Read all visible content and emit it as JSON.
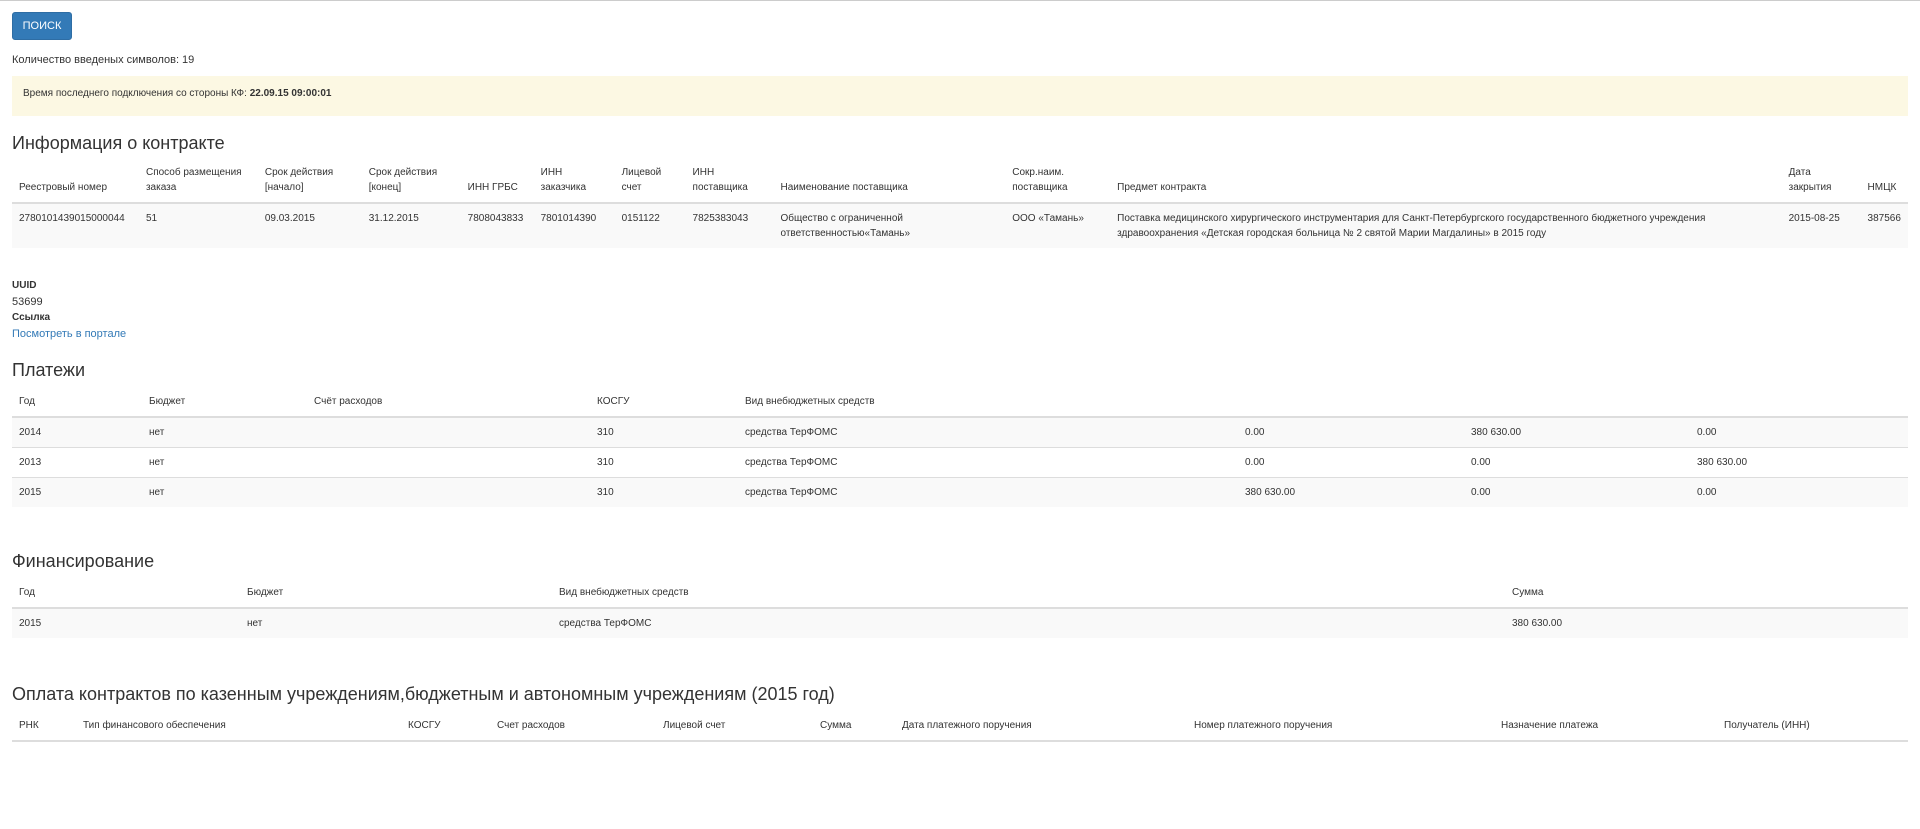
{
  "search_button": "ПОИСК",
  "symbol_count": "Количество введеных символов: 19",
  "alert": {
    "prefix": "Время последнего подключения со стороны КФ: ",
    "value": "22.09.15 09:00:01"
  },
  "contract": {
    "title": "Информация о контракте",
    "headers": [
      "Реестровый номер",
      "Способ размещения заказа",
      "Срок действия [начало]",
      "Срок действия [конец]",
      "ИНН ГРБС",
      "ИНН заказчика",
      "Лицевой счет",
      "ИНН поставщика",
      "Наименование поставщика",
      "Сокр.наим. поставщика",
      "Предмет контракта",
      "Дата закрытия",
      "НМЦК"
    ],
    "row": [
      "2780101439015000044",
      "51",
      "09.03.2015",
      "31.12.2015",
      "7808043833",
      "7801014390",
      "0151122",
      "7825383043",
      "Общество с ограниченной ответственностью«Тамань»",
      "ООО «Тамань»",
      "Поставка медицинского хирургического инструментария для Санкт-Петербургского государственного бюджетного учреждения здравоохранения «Детская городская больница № 2 святой Марии Магдалины» в 2015 году",
      "2015-08-25",
      "387566"
    ]
  },
  "uuid_label": "UUID",
  "uuid_value": "53699",
  "link_label": "Ссылка",
  "link_text": "Посмотреть в портале",
  "payments": {
    "title": "Платежи",
    "headers": [
      "Год",
      "Бюджет",
      "Счёт расходов",
      "КОСГУ",
      "Вид внебюджетных средств",
      "",
      "",
      ""
    ],
    "rows": [
      [
        "2014",
        "нет",
        "",
        "310",
        "средства ТерФОМС",
        "0.00",
        "380 630.00",
        "0.00"
      ],
      [
        "2013",
        "нет",
        "",
        "310",
        "средства ТерФОМС",
        "0.00",
        "0.00",
        "380 630.00"
      ],
      [
        "2015",
        "нет",
        "",
        "310",
        "средства ТерФОМС",
        "380 630.00",
        "0.00",
        "0.00"
      ]
    ]
  },
  "financing": {
    "title": "Финансирование",
    "headers": [
      "Год",
      "Бюджет",
      "Вид внебюджетных средств",
      "Сумма"
    ],
    "rows": [
      [
        "2015",
        "нет",
        "средства ТерФОМС",
        "380 630.00"
      ]
    ]
  },
  "payments2015": {
    "title": "Оплата контрактов по казенным учреждениям,бюджетным и автономным учреждениям (2015 год)",
    "headers": [
      "РНК",
      "Тип финансового обеспечения",
      "КОСГУ",
      "Счет расходов",
      "Лицевой счет",
      "Сумма",
      "Дата платежного поручения",
      "Номер платежного поручения",
      "Назначение платежа",
      "Получатель (ИНН)"
    ]
  }
}
